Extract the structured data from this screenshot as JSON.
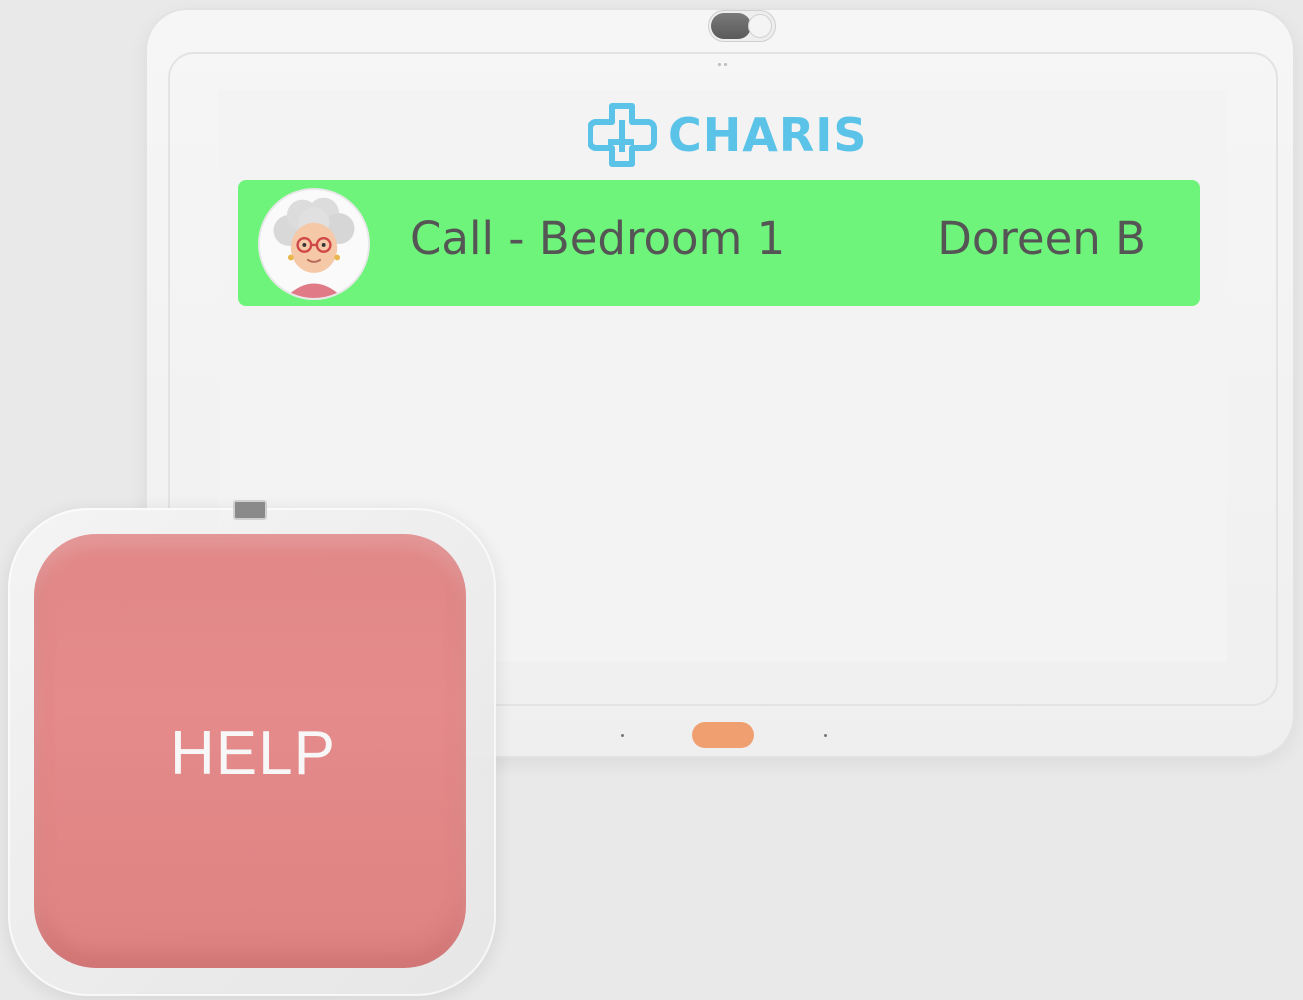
{
  "app": {
    "brand_name": "CHARIS",
    "logo_icon": "medical-cross-icon",
    "brand_color": "#5cc3e8"
  },
  "alert": {
    "title": "Call - Bedroom 1",
    "resident_name": "Doreen B",
    "avatar_icon": "elderly-woman-avatar",
    "status_color": "#6ef47a"
  },
  "pendant": {
    "label": "HELP",
    "color": "#e08080"
  },
  "device": {
    "home_button_color": "#f0a070"
  }
}
